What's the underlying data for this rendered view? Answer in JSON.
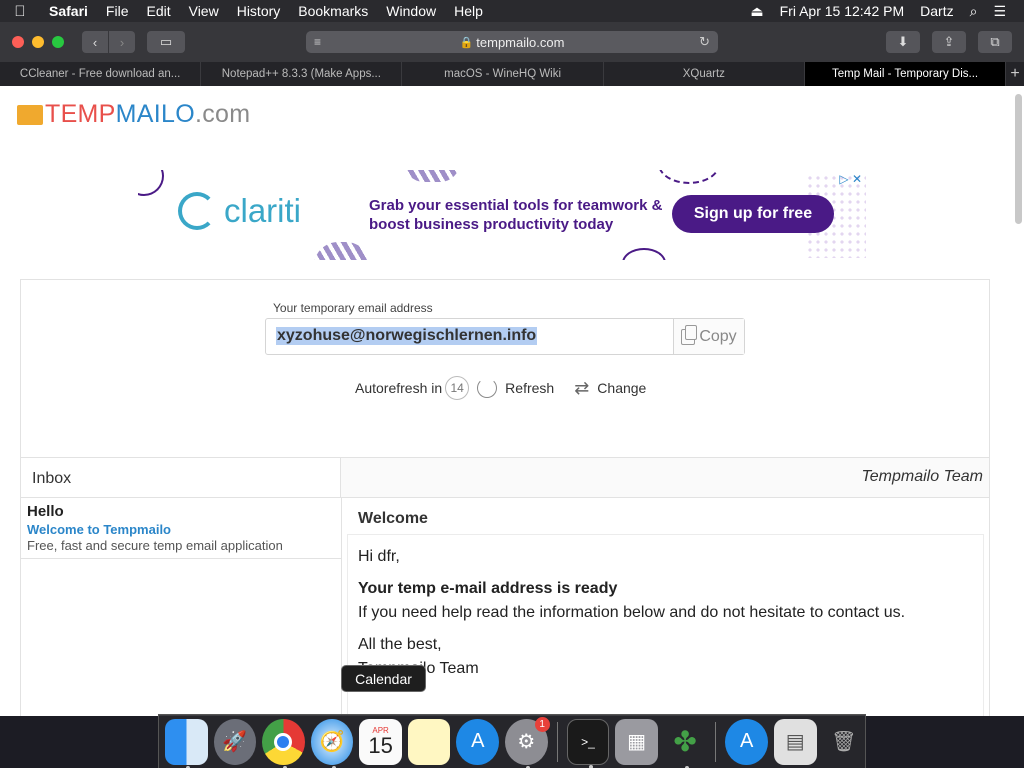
{
  "menubar": {
    "app": "Safari",
    "items": [
      "File",
      "Edit",
      "View",
      "History",
      "Bookmarks",
      "Window",
      "Help"
    ],
    "datetime": "Fri Apr 15  12:42 PM",
    "user": "Dartz"
  },
  "toolbar": {
    "address": "tempmailo.com"
  },
  "tabs": [
    {
      "label": "CCleaner - Free download an..."
    },
    {
      "label": "Notepad++ 8.3.3 (Make Apps..."
    },
    {
      "label": "macOS - WineHQ Wiki"
    },
    {
      "label": "XQuartz"
    },
    {
      "label": "Temp Mail - Temporary Dis..."
    }
  ],
  "logo": {
    "part1": "TEMP",
    "part2": "MAILO",
    "part3": ".com"
  },
  "ad": {
    "brand": "clariti",
    "headline": "Grab your essential tools for teamwork & boost business productivity today",
    "cta": "Sign up for free",
    "close": "✕"
  },
  "email": {
    "label": "Your temporary email address",
    "address": "xyzohuse@norwegischlernen.info",
    "copy_label": "Copy"
  },
  "actions": {
    "autorefresh_label": "Autorefresh in",
    "countdown": "14",
    "refresh_label": "Refresh",
    "change_label": "Change"
  },
  "inbox": {
    "title": "Inbox",
    "team": "Tempmailo Team",
    "items": [
      {
        "from": "Hello",
        "subject": "Welcome to Tempmailo",
        "preview": "Free, fast and secure temp email application"
      }
    ]
  },
  "message": {
    "subject": "Welcome",
    "greeting": "Hi dfr,",
    "heading": "Your temp e-mail address is ready",
    "body": "If you need help read the information below and do not hesitate to contact us.",
    "closing": "All the best,",
    "signature": "Tempmailo Team"
  },
  "dock": {
    "tooltip": "Calendar",
    "calendar_month": "APR",
    "calendar_day": "15",
    "settings_badge": "1"
  }
}
